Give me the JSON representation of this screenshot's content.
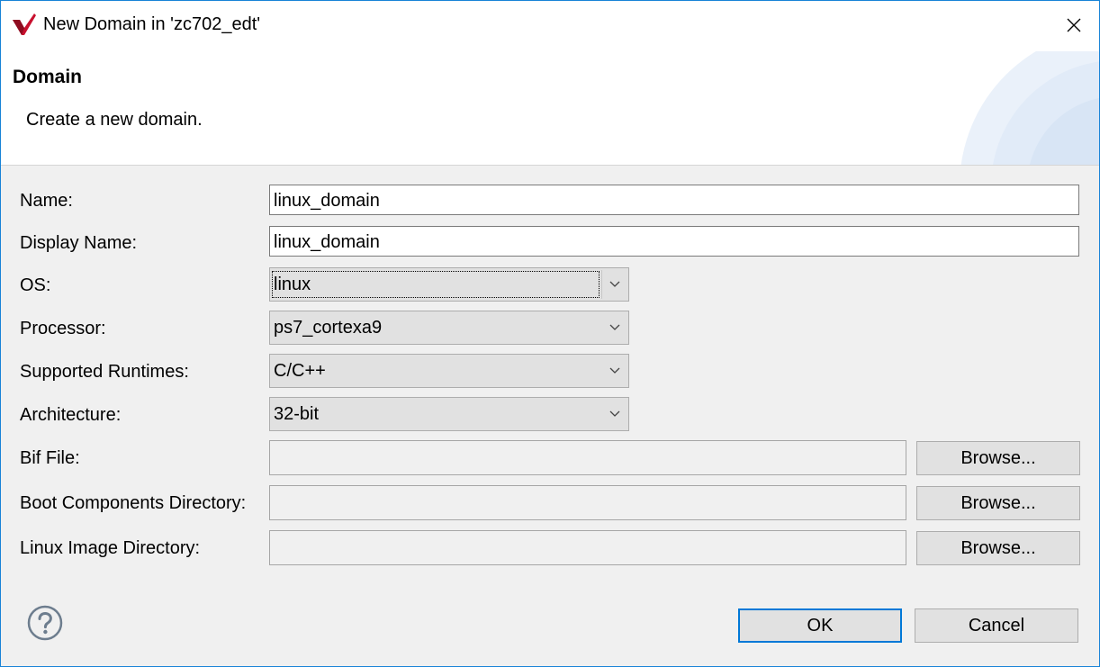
{
  "window": {
    "title": "New Domain in 'zc702_edt'"
  },
  "header": {
    "title": "Domain",
    "description": "Create a new domain."
  },
  "form": {
    "name": {
      "label": "Name:",
      "value": "linux_domain"
    },
    "display_name": {
      "label": "Display Name:",
      "value": "linux_domain"
    },
    "os": {
      "label": "OS:",
      "value": "linux"
    },
    "processor": {
      "label": "Processor:",
      "value": "ps7_cortexa9"
    },
    "runtimes": {
      "label": "Supported Runtimes:",
      "value": "C/C++"
    },
    "architecture": {
      "label": "Architecture:",
      "value": "32-bit"
    },
    "bif_file": {
      "label": "Bif File:",
      "value": "",
      "browse_label": "Browse..."
    },
    "boot_dir": {
      "label": "Boot Components Directory:",
      "value": "",
      "browse_label": "Browse..."
    },
    "linux_dir": {
      "label": "Linux Image Directory:",
      "value": "",
      "browse_label": "Browse..."
    }
  },
  "buttons": {
    "ok": "OK",
    "cancel": "Cancel"
  },
  "icons": {
    "app": "vitis-logo-icon",
    "close": "close-icon",
    "help": "help-icon",
    "dropdown": "chevron-down-icon"
  },
  "colors": {
    "accent": "#0078d7",
    "logo": "#c8102e"
  }
}
